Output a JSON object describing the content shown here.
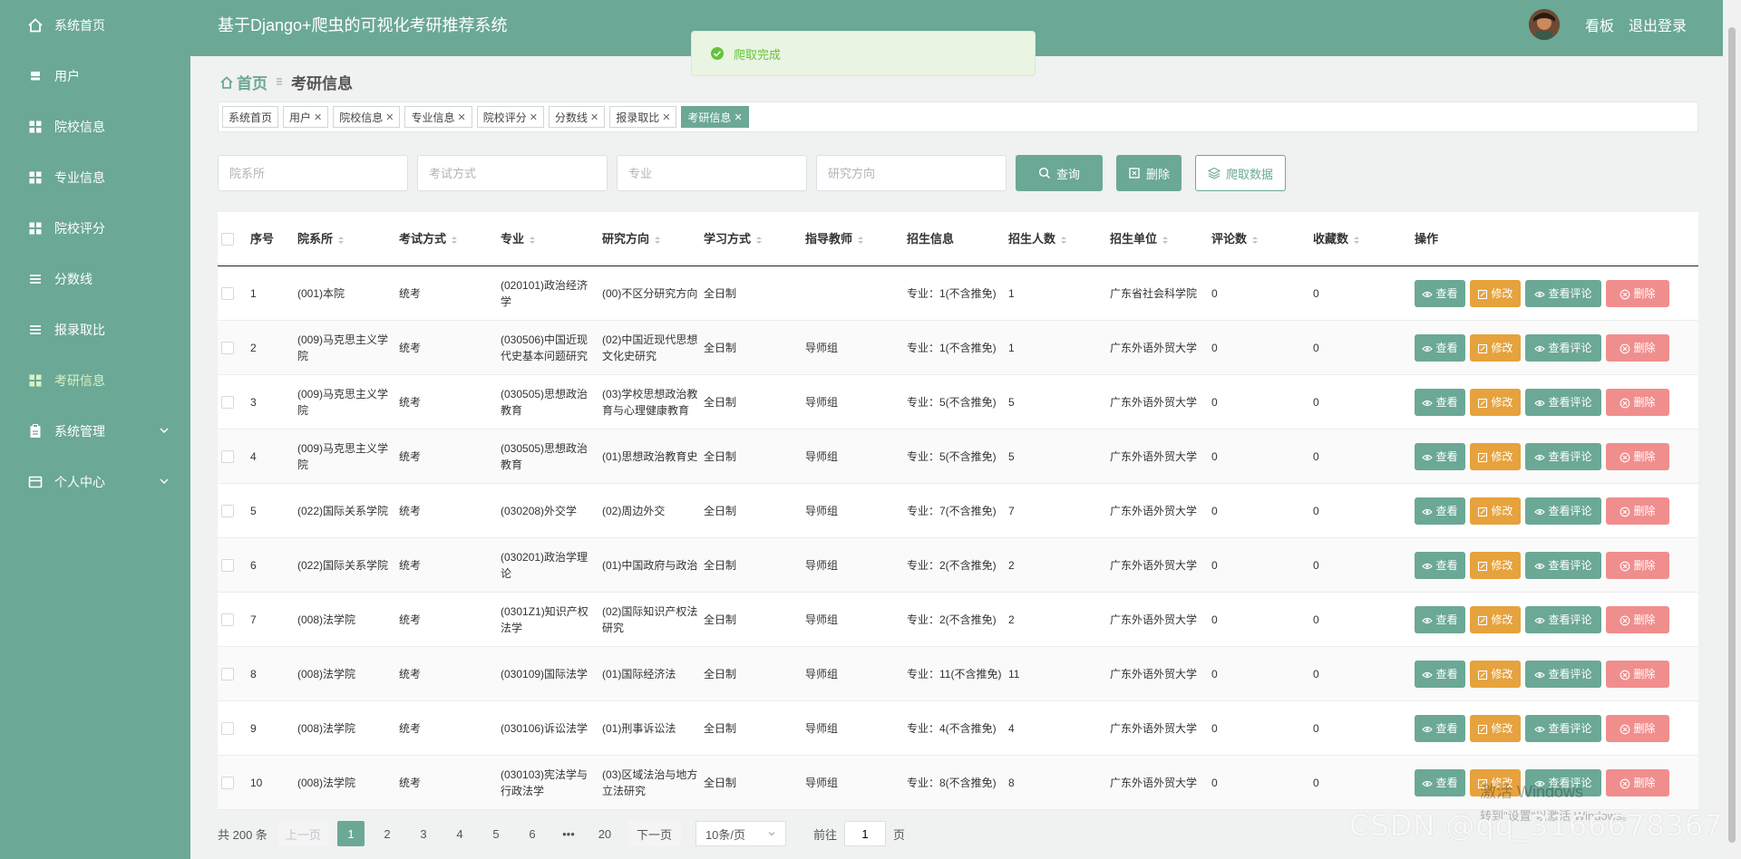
{
  "sidebar": {
    "items": [
      {
        "label": "系统首页",
        "icon": "home-icon"
      },
      {
        "label": "用户",
        "icon": "user-icon"
      },
      {
        "label": "院校信息",
        "icon": "grid-icon"
      },
      {
        "label": "专业信息",
        "icon": "grid-icon"
      },
      {
        "label": "院校评分",
        "icon": "grid-icon"
      },
      {
        "label": "分数线",
        "icon": "list-icon"
      },
      {
        "label": "报录取比",
        "icon": "list-icon"
      },
      {
        "label": "考研信息",
        "icon": "grid-icon",
        "active": true
      },
      {
        "label": "系统管理",
        "icon": "clipboard-icon",
        "expandable": true
      },
      {
        "label": "个人中心",
        "icon": "card-icon",
        "expandable": true
      }
    ]
  },
  "header": {
    "title": "基于Django+爬虫的可视化考研推荐系统",
    "board_label": "看板",
    "logout_label": "退出登录"
  },
  "toast": {
    "message": "爬取完成"
  },
  "breadcrumb": {
    "home": "首页",
    "current": "考研信息"
  },
  "tags": [
    {
      "label": "系统首页",
      "closable": false
    },
    {
      "label": "用户",
      "closable": true
    },
    {
      "label": "院校信息",
      "closable": true
    },
    {
      "label": "专业信息",
      "closable": true
    },
    {
      "label": "院校评分",
      "closable": true
    },
    {
      "label": "分数线",
      "closable": true
    },
    {
      "label": "报录取比",
      "closable": true
    },
    {
      "label": "考研信息",
      "closable": true,
      "active": true
    }
  ],
  "search": {
    "dept_placeholder": "院系所",
    "exam_placeholder": "考试方式",
    "major_placeholder": "专业",
    "direction_placeholder": "研究方向",
    "query_label": "查询",
    "delete_label": "删除",
    "crawl_label": "爬取数据"
  },
  "table": {
    "headers": [
      "序号",
      "院系所",
      "考试方式",
      "专业",
      "研究方向",
      "学习方式",
      "指导教师",
      "招生信息",
      "招生人数",
      "招生单位",
      "评论数",
      "收藏数",
      "操作"
    ],
    "rows": [
      [
        "1",
        "(001)本院",
        "统考",
        "(020101)政治经济学",
        "(00)不区分研究方向",
        "全日制",
        "",
        "专业：1(不含推免)",
        "1",
        "广东省社会科学院",
        "0",
        "0"
      ],
      [
        "2",
        "(009)马克思主义学院",
        "统考",
        "(030506)中国近现代史基本问题研究",
        "(02)中国近现代思想文化史研究",
        "全日制",
        "导师组",
        "专业：1(不含推免)",
        "1",
        "广东外语外贸大学",
        "0",
        "0"
      ],
      [
        "3",
        "(009)马克思主义学院",
        "统考",
        "(030505)思想政治教育",
        "(03)学校思想政治教育与心理健康教育",
        "全日制",
        "导师组",
        "专业：5(不含推免)",
        "5",
        "广东外语外贸大学",
        "0",
        "0"
      ],
      [
        "4",
        "(009)马克思主义学院",
        "统考",
        "(030505)思想政治教育",
        "(01)思想政治教育史",
        "全日制",
        "导师组",
        "专业：5(不含推免)",
        "5",
        "广东外语外贸大学",
        "0",
        "0"
      ],
      [
        "5",
        "(022)国际关系学院",
        "统考",
        "(030208)外交学",
        "(02)周边外交",
        "全日制",
        "导师组",
        "专业：7(不含推免)",
        "7",
        "广东外语外贸大学",
        "0",
        "0"
      ],
      [
        "6",
        "(022)国际关系学院",
        "统考",
        "(030201)政治学理论",
        "(01)中国政府与政治",
        "全日制",
        "导师组",
        "专业：2(不含推免)",
        "2",
        "广东外语外贸大学",
        "0",
        "0"
      ],
      [
        "7",
        "(008)法学院",
        "统考",
        "(0301Z1)知识产权法学",
        "(02)国际知识产权法研究",
        "全日制",
        "导师组",
        "专业：2(不含推免)",
        "2",
        "广东外语外贸大学",
        "0",
        "0"
      ],
      [
        "8",
        "(008)法学院",
        "统考",
        "(030109)国际法学",
        "(01)国际经济法",
        "全日制",
        "导师组",
        "专业：11(不含推免)",
        "11",
        "广东外语外贸大学",
        "0",
        "0"
      ],
      [
        "9",
        "(008)法学院",
        "统考",
        "(030106)诉讼法学",
        "(01)刑事诉讼法",
        "全日制",
        "导师组",
        "专业：4(不含推免)",
        "4",
        "广东外语外贸大学",
        "0",
        "0"
      ],
      [
        "10",
        "(008)法学院",
        "统考",
        "(030103)宪法学与行政法学",
        "(03)区域法治与地方立法研究",
        "全日制",
        "导师组",
        "专业：8(不含推免)",
        "8",
        "广东外语外贸大学",
        "0",
        "0"
      ]
    ],
    "actions": {
      "view": "查看",
      "edit": "修改",
      "comments": "查看评论",
      "delete": "删除"
    }
  },
  "pagination": {
    "total": "共 200 条",
    "prev": "上一页",
    "pages": [
      "1",
      "2",
      "3",
      "4",
      "5",
      "6",
      "•••",
      "20"
    ],
    "current": "1",
    "next": "下一页",
    "page_size": "10条/页",
    "goto_label": "前往",
    "goto_value": "1",
    "page_suffix": "页"
  },
  "watermarks": {
    "windows_line1": "激活 Windows",
    "windows_line2": "转到\"设置\"以激活 Windows。",
    "csdn": "CSDN @qq_3166678367"
  },
  "colors": {
    "primary": "#6ba896",
    "warning": "#e6a23c",
    "danger": "#f08e8e",
    "success": "#67c23a"
  }
}
